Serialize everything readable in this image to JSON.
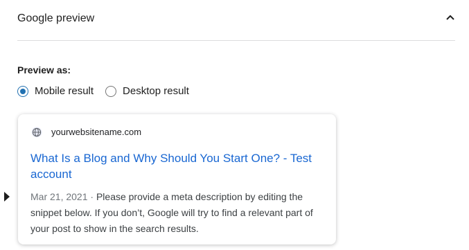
{
  "panel": {
    "title": "Google preview",
    "toggle_icon": "chevron-up-icon"
  },
  "preview_as": {
    "label": "Preview as:",
    "options": [
      {
        "label": "Mobile result",
        "checked": true
      },
      {
        "label": "Desktop result",
        "checked": false
      }
    ]
  },
  "snippet": {
    "site_icon": "globe-icon",
    "url": "yourwebsitename.com",
    "title": "What Is a Blog and Why Should You Start One? - Test account",
    "date": "Mar 21, 2021",
    "separator": " · ",
    "description": "Please provide a meta description by editing the snippet below. If you don’t, Google will try to find a relevant part of your post to show in the search results."
  },
  "colors": {
    "accent": "#2271b1",
    "link": "#1967d2",
    "text": "#1e1e1e",
    "muted": "#70757a"
  }
}
